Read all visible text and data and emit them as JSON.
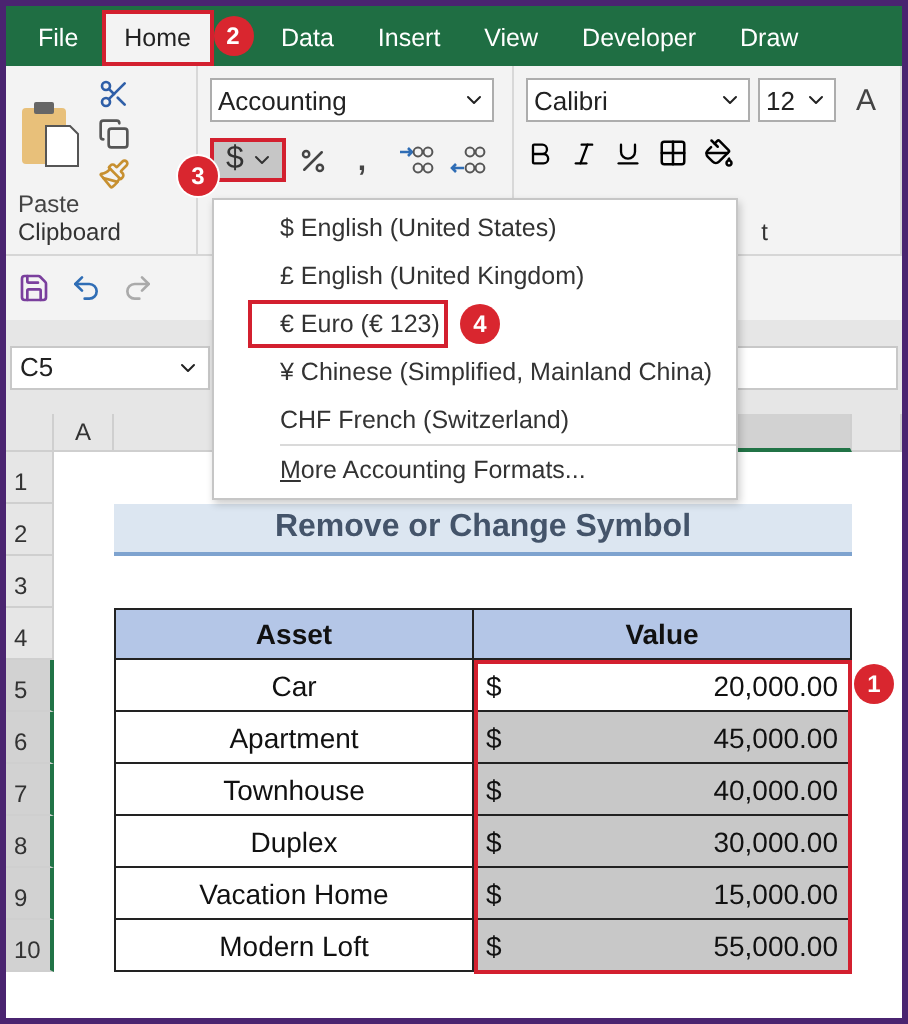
{
  "ribbon_tabs": [
    {
      "label": "File",
      "selected": false,
      "outlined": false
    },
    {
      "label": "Home",
      "selected": true,
      "outlined": true,
      "step": "2"
    },
    {
      "label": "Data",
      "selected": false,
      "outlined": false
    },
    {
      "label": "Insert",
      "selected": false,
      "outlined": false
    },
    {
      "label": "View",
      "selected": false,
      "outlined": false
    },
    {
      "label": "Developer",
      "selected": false,
      "outlined": false
    },
    {
      "label": "Draw",
      "selected": false,
      "outlined": false
    }
  ],
  "clipboard": {
    "paste_label": "Paste",
    "group_label": "Clipboard"
  },
  "number": {
    "format": "Accounting",
    "currency_symbol": "$",
    "currency_outlined": true,
    "currency_step": "3",
    "comma": ","
  },
  "font": {
    "name": "Calibri",
    "size": "12",
    "grow": "A",
    "group_label": "t"
  },
  "currency_menu": {
    "items": [
      {
        "label": "$ English (United States)",
        "outlined": false
      },
      {
        "label": "£ English (United Kingdom)",
        "outlined": false
      },
      {
        "label": "€ Euro (€ 123)",
        "outlined": true,
        "step": "4"
      },
      {
        "label": "¥ Chinese (Simplified, Mainland China)",
        "outlined": false
      },
      {
        "label": "CHF French (Switzerland)",
        "outlined": false
      }
    ],
    "more": {
      "label": "More Accounting Formats..."
    }
  },
  "name_box": "C5",
  "column_headers": [
    {
      "label": "A",
      "selected": false
    },
    {
      "selected": false
    },
    {
      "selected": true
    }
  ],
  "row_headers": [
    {
      "label": "1",
      "selected": false
    },
    {
      "label": "2",
      "selected": false
    },
    {
      "label": "3",
      "selected": false
    },
    {
      "label": "4",
      "selected": false
    },
    {
      "label": "5",
      "selected": true
    },
    {
      "label": "6",
      "selected": true
    },
    {
      "label": "7",
      "selected": true
    },
    {
      "label": "8",
      "selected": true
    },
    {
      "label": "9",
      "selected": true
    },
    {
      "label": "10",
      "selected": true
    }
  ],
  "title": "Remove or Change Symbol",
  "table": {
    "columns": [
      "Asset",
      "Value"
    ],
    "step": "1",
    "rows": [
      {
        "asset": "Car",
        "symbol": "$",
        "amount": "20,000.00",
        "highlighted": false
      },
      {
        "asset": "Apartment",
        "symbol": "$",
        "amount": "45,000.00",
        "highlighted": true
      },
      {
        "asset": "Townhouse",
        "symbol": "$",
        "amount": "40,000.00",
        "highlighted": true
      },
      {
        "asset": "Duplex",
        "symbol": "$",
        "amount": "30,000.00",
        "highlighted": true
      },
      {
        "asset": "Vacation Home",
        "symbol": "$",
        "amount": "15,000.00",
        "highlighted": true
      },
      {
        "asset": "Modern Loft",
        "symbol": "$",
        "amount": "55,000.00",
        "highlighted": true
      }
    ]
  }
}
